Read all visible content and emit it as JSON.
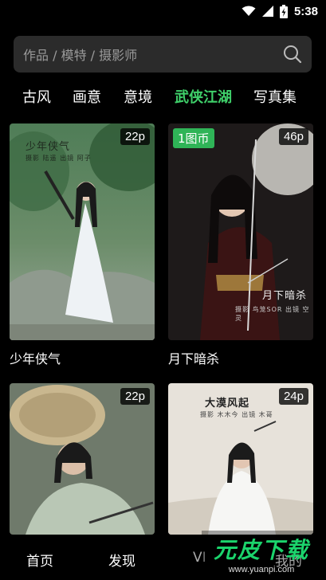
{
  "status_bar": {
    "time": "5:38",
    "icons": [
      "wifi-icon",
      "signal-icon",
      "battery-charging-icon"
    ]
  },
  "search": {
    "placeholder": "作品 / 模特 / 摄影师",
    "icon": "search-icon"
  },
  "tabs": [
    {
      "label": "古风",
      "active": false
    },
    {
      "label": "画意",
      "active": false
    },
    {
      "label": "意境",
      "active": false
    },
    {
      "label": "武侠江湖",
      "active": true
    },
    {
      "label": "写真集",
      "active": false
    }
  ],
  "cards": [
    {
      "title": "少年侠气",
      "pages": "22p",
      "photo_title": "少年侠气",
      "photo_credit": "摄影 陆遥 出镜 阿子"
    },
    {
      "title": "月下暗杀",
      "pages": "46p",
      "coin_badge": "1图币",
      "photo_title": "月下暗杀",
      "photo_credit": "摄影 鸟笼SOR 出镜 空灵"
    },
    {
      "title": "",
      "pages": "22p"
    },
    {
      "title": "",
      "pages": "24p",
      "photo_title": "大漠风起",
      "photo_credit": "摄影 木木今 出镜 木哥"
    }
  ],
  "bottom_nav": [
    {
      "label": "首页"
    },
    {
      "label": "发现"
    },
    {
      "label": "VI"
    },
    {
      "label": "我的"
    }
  ],
  "watermark": {
    "logo": "元皮下载",
    "url": "www.yuanpi.com"
  },
  "colors": {
    "accent": "#3fd06a",
    "coin_badge": "#2fb457",
    "search_bg": "#2b2b2b"
  }
}
